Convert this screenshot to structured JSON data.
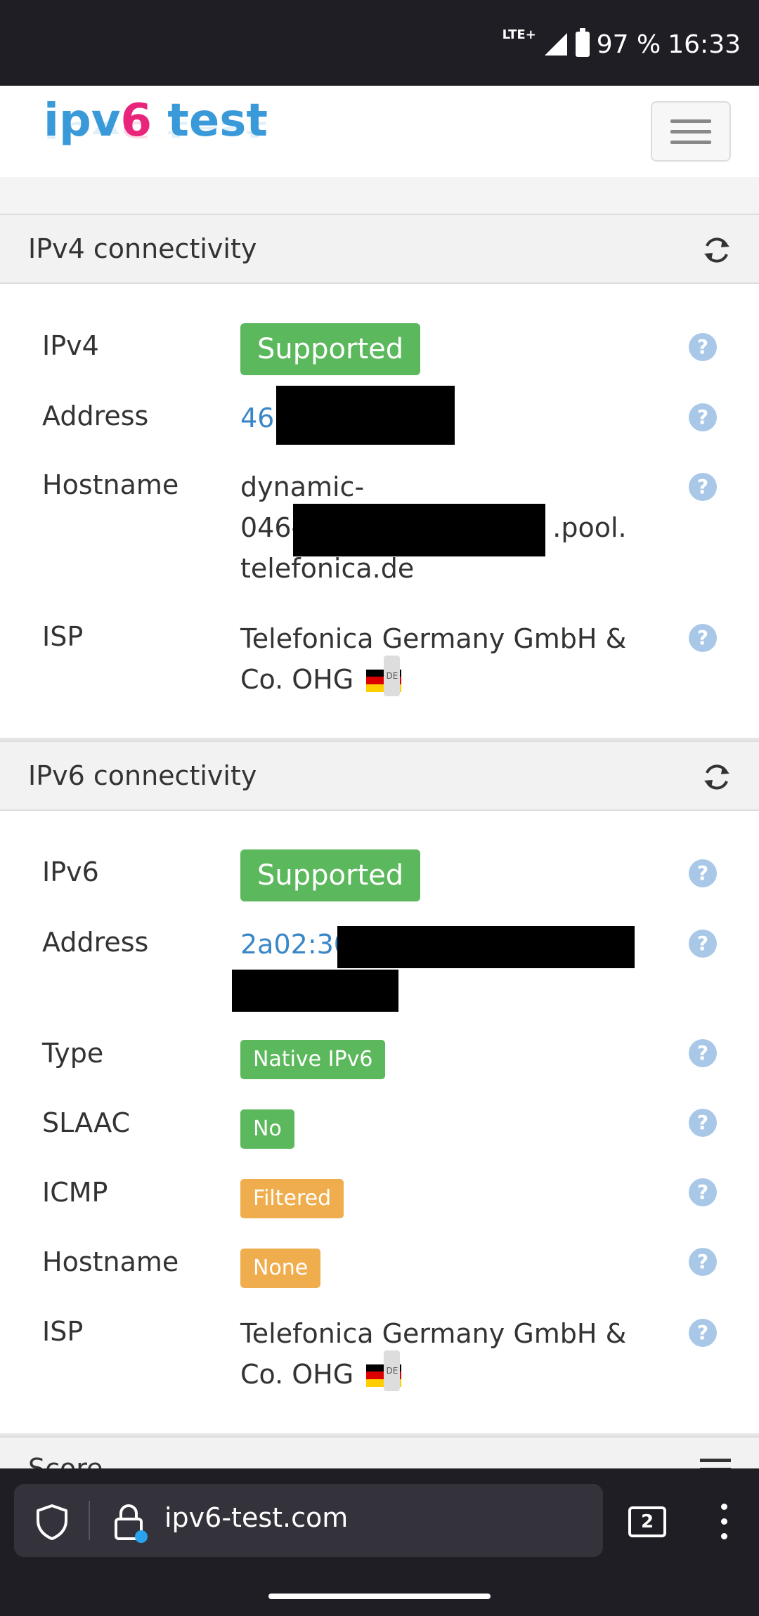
{
  "status_bar": {
    "network": "LTE+",
    "battery": "97 %",
    "time": "16:33"
  },
  "header": {
    "logo_part1": "ipv",
    "logo_part2": "6",
    "logo_part3": " test"
  },
  "ipv4": {
    "title": "IPv4 connectivity",
    "rows": {
      "ipv4": {
        "label": "IPv4",
        "value": "Supported"
      },
      "address": {
        "label": "Address",
        "value": "46."
      },
      "hostname": {
        "label": "Hostname",
        "line1": "dynamic-",
        "line2a": "046-",
        "line2b": ".pool.",
        "line3": "telefonica.de"
      },
      "isp": {
        "label": "ISP",
        "line1": "Telefonica Germany GmbH &",
        "line2": "Co. OHG",
        "flag_code": "DE"
      }
    }
  },
  "ipv6": {
    "title": "IPv6 connectivity",
    "rows": {
      "ipv6": {
        "label": "IPv6",
        "value": "Supported"
      },
      "address": {
        "label": "Address",
        "value": "2a02:30"
      },
      "type": {
        "label": "Type",
        "value": "Native IPv6"
      },
      "slaac": {
        "label": "SLAAC",
        "value": "No"
      },
      "icmp": {
        "label": "ICMP",
        "value": "Filtered"
      },
      "hostname": {
        "label": "Hostname",
        "value": "None"
      },
      "isp": {
        "label": "ISP",
        "line1": "Telefonica Germany GmbH &",
        "line2": "Co. OHG",
        "flag_code": "DE"
      }
    }
  },
  "score_section": {
    "title": "Score"
  },
  "browser": {
    "url": "ipv6-test.com",
    "tab_count": "2"
  },
  "colors": {
    "green_badge": "#5cb85c",
    "orange_badge": "#f0ad4e",
    "link": "#3a87c8",
    "help_icon": "#a9c8e8",
    "logo_blue": "#3a9ad9",
    "logo_pink": "#e8257a"
  },
  "icons": {
    "refresh": "refresh-icon",
    "help": "question-circle-icon",
    "menu": "hamburger-icon",
    "shield": "shield-icon",
    "lock": "lock-icon",
    "more": "more-vertical-icon",
    "tabs": "tabs-icon",
    "flag": "germany-flag-icon"
  }
}
